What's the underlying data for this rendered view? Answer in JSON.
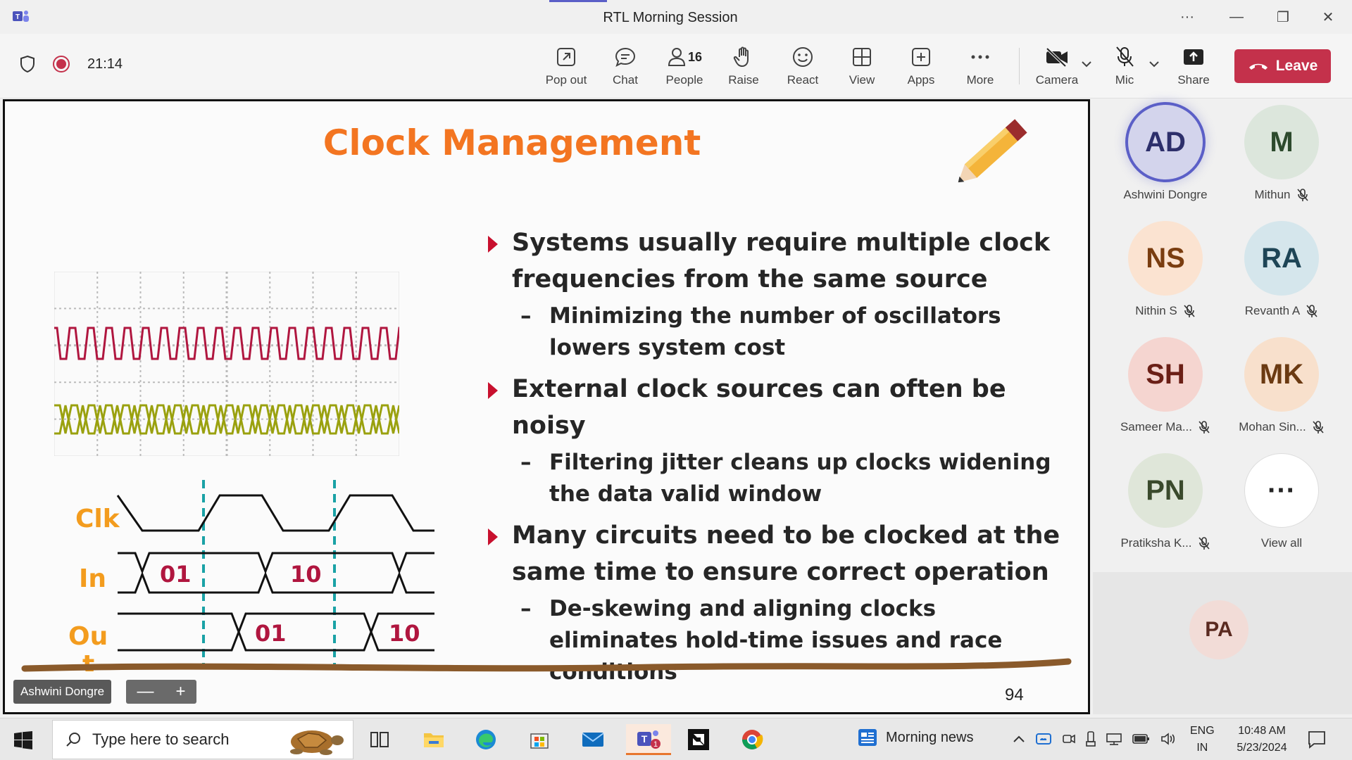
{
  "window": {
    "title": "RTL Morning Session",
    "controls": {
      "more": "···",
      "minimize": "—",
      "restore": "❐",
      "close": "✕"
    }
  },
  "toolbar": {
    "timer": "21:14",
    "buttons": {
      "popout": "Pop out",
      "chat": "Chat",
      "people": "People",
      "people_count": "16",
      "raise": "Raise",
      "react": "React",
      "view": "View",
      "apps": "Apps",
      "more": "More",
      "camera": "Camera",
      "mic": "Mic",
      "share": "Share",
      "leave": "Leave"
    },
    "colors": {
      "leave": "#c4314b",
      "record": "#c4314b"
    }
  },
  "slide": {
    "title": "Clock Management",
    "bullets": [
      {
        "text": "Systems usually require multiple clock frequencies from the same source",
        "sub": "Minimizing the number of oscillators lowers system cost"
      },
      {
        "text": "External clock sources can often be noisy",
        "sub": "Filtering jitter cleans up clocks widening the data valid window"
      },
      {
        "text": "Many circuits need to be clocked at the same time to ensure correct operation",
        "sub": "De-skewing and aligning clocks eliminates hold-time issues and race conditions"
      }
    ],
    "sub_dash": "–",
    "timing": {
      "clk_label": "Clk",
      "in_label": "In",
      "out_label": "Ou",
      "out_label_2": "t",
      "in_values": [
        "01",
        "10"
      ],
      "out_values": [
        "01",
        "10"
      ]
    },
    "page_number": "94",
    "colors": {
      "title": "#f37521",
      "arrow": "#c8102e",
      "signal_label": "#f39c1e",
      "bus_value": "#b0163f",
      "trace1": "#b0163f",
      "trace2": "#9aa10f",
      "dashed": "#1aa2a6",
      "underline": "#8a5a2b"
    }
  },
  "presenter": {
    "name": "Ashwini Dongre",
    "zoom_out": "—",
    "zoom_in": "+"
  },
  "participants": [
    {
      "initials": "AD",
      "name": "Ashwini Dongre",
      "muted": false,
      "speaking": true,
      "bg": "#d3d4ec",
      "fg": "#2d2f6b"
    },
    {
      "initials": "M",
      "name": "Mithun",
      "muted": true,
      "bg": "#dce6dc",
      "fg": "#2d4a2d"
    },
    {
      "initials": "NS",
      "name": "Nithin S",
      "muted": true,
      "bg": "#fbe3d1",
      "fg": "#7a3d10"
    },
    {
      "initials": "RA",
      "name": "Revanth A",
      "muted": true,
      "bg": "#d5e6ec",
      "fg": "#1e4556"
    },
    {
      "initials": "SH",
      "name": "Sameer Ma...",
      "muted": true,
      "bg": "#f5d5d0",
      "fg": "#6b1f16"
    },
    {
      "initials": "MK",
      "name": "Mohan Sin...",
      "muted": true,
      "bg": "#f8e0cc",
      "fg": "#6b3a12"
    },
    {
      "initials": "PN",
      "name": "Pratiksha K...",
      "muted": true,
      "bg": "#dfe6d9",
      "fg": "#3a4a2c"
    },
    {
      "initials": "···",
      "name": "View all",
      "muted": false,
      "bg": "#ffffff",
      "fg": "#242424"
    }
  ],
  "spotlight": {
    "initials": "PA"
  },
  "taskbar": {
    "search_placeholder": "Type here to search",
    "news": "Morning news",
    "lang_1": "ENG",
    "lang_2": "IN",
    "time": "10:48 AM",
    "date": "5/23/2024",
    "teams_badge": "1"
  }
}
